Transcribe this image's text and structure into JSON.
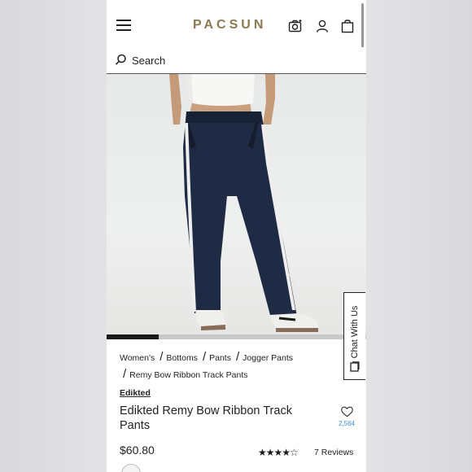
{
  "header": {
    "logo": "PACSUN"
  },
  "search": {
    "label": "Search"
  },
  "product": {
    "breadcrumb": [
      {
        "label": "Women's"
      },
      {
        "label": "Bottoms"
      },
      {
        "label": "Pants"
      },
      {
        "label": "Jogger Pants"
      },
      {
        "label": "Remy Bow Ribbon Track Pants"
      }
    ],
    "brand": "Edikted",
    "title": "Edikted Remy Bow Ribbon Track Pants",
    "wishlist_count": "2,564",
    "price": "$60.80",
    "rating_value": 4,
    "rating_stars": "★★★★☆",
    "reviews": "7 Reviews",
    "gallery_progress": 0.2
  },
  "chat": {
    "label": "Chat With Us"
  },
  "colors": {
    "brand_gold": "#8c7a50",
    "pants_navy": "#1f2a44",
    "link_blue": "#3a8ee6"
  }
}
